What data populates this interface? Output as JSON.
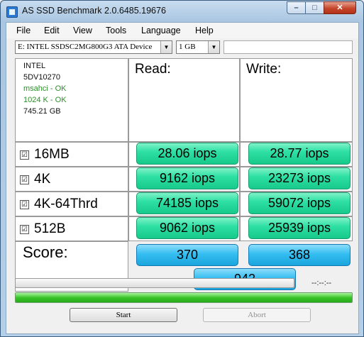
{
  "window": {
    "title": "AS SSD Benchmark 2.0.6485.19676",
    "min_label": "–",
    "max_label": "□",
    "close_label": "✕"
  },
  "menu": [
    "File",
    "Edit",
    "View",
    "Tools",
    "Language",
    "Help"
  ],
  "toolbar": {
    "drive": "E: INTEL SSDSC2MG800G3 ATA Device",
    "size": "1 GB",
    "arrow": "▼"
  },
  "info": {
    "vendor": "INTEL",
    "firmware": "5DV10270",
    "driver": "msahci - OK",
    "alignment": "1024 K - OK",
    "capacity": "745.21 GB"
  },
  "headers": {
    "read": "Read:",
    "write": "Write:"
  },
  "rows": [
    {
      "label": "16MB",
      "checked": "☑",
      "read": "28.06 iops",
      "write": "28.77 iops"
    },
    {
      "label": "4K",
      "checked": "☑",
      "read": "9162 iops",
      "write": "23273 iops"
    },
    {
      "label": "4K-64Thrd",
      "checked": "☑",
      "read": "74185 iops",
      "write": "59072 iops"
    },
    {
      "label": "512B",
      "checked": "☑",
      "read": "9062 iops",
      "write": "25939 iops"
    }
  ],
  "score": {
    "label": "Score:",
    "read": "370",
    "write": "368",
    "total": "942"
  },
  "progress": {
    "time": "--:--:--",
    "fraction": 1.0
  },
  "buttons": {
    "start": "Start",
    "abort": "Abort"
  },
  "colors": {
    "result_green": "#2fe0a4",
    "score_blue": "#34bdf0",
    "progress_green": "#3ac42a",
    "ok_text": "#2f8f2f"
  }
}
